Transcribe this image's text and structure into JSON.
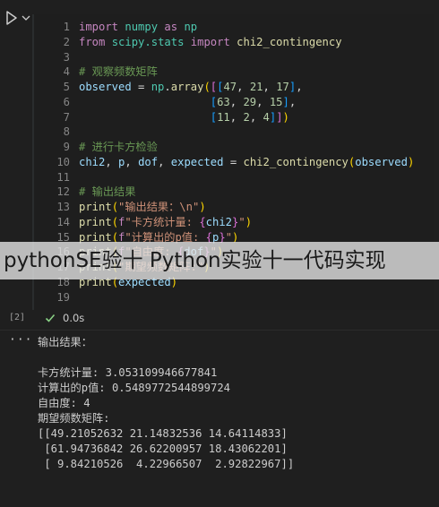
{
  "cell": {
    "execution_count": "[2]",
    "status_icon": "check-icon",
    "exec_time": "0.0s",
    "lines": [
      {
        "n": "1",
        "tokens": [
          [
            "kw",
            "import"
          ],
          [
            "op",
            " "
          ],
          [
            "mod",
            "numpy"
          ],
          [
            "op",
            " "
          ],
          [
            "kw",
            "as"
          ],
          [
            "op",
            " "
          ],
          [
            "mod",
            "np"
          ]
        ]
      },
      {
        "n": "2",
        "tokens": [
          [
            "kw",
            "from"
          ],
          [
            "op",
            " "
          ],
          [
            "mod",
            "scipy.stats"
          ],
          [
            "op",
            " "
          ],
          [
            "kw",
            "import"
          ],
          [
            "op",
            " "
          ],
          [
            "fn",
            "chi2_contingency"
          ]
        ]
      },
      {
        "n": "3",
        "tokens": []
      },
      {
        "n": "4",
        "tokens": [
          [
            "cm",
            "# 观察频数矩阵"
          ]
        ]
      },
      {
        "n": "5",
        "tokens": [
          [
            "var",
            "observed"
          ],
          [
            "op",
            " = "
          ],
          [
            "mod",
            "np"
          ],
          [
            "op",
            "."
          ],
          [
            "fn",
            "array"
          ],
          [
            "br1",
            "("
          ],
          [
            "br2",
            "["
          ],
          [
            "br3",
            "["
          ],
          [
            "num",
            "47"
          ],
          [
            "op",
            ", "
          ],
          [
            "num",
            "21"
          ],
          [
            "op",
            ", "
          ],
          [
            "num",
            "17"
          ],
          [
            "br3",
            "]"
          ],
          [
            "op",
            ","
          ]
        ]
      },
      {
        "n": "6",
        "tokens": [
          [
            "op",
            "                    "
          ],
          [
            "br3",
            "["
          ],
          [
            "num",
            "63"
          ],
          [
            "op",
            ", "
          ],
          [
            "num",
            "29"
          ],
          [
            "op",
            ", "
          ],
          [
            "num",
            "15"
          ],
          [
            "br3",
            "]"
          ],
          [
            "op",
            ","
          ]
        ]
      },
      {
        "n": "7",
        "tokens": [
          [
            "op",
            "                    "
          ],
          [
            "br3",
            "["
          ],
          [
            "num",
            "11"
          ],
          [
            "op",
            ", "
          ],
          [
            "num",
            "2"
          ],
          [
            "op",
            ", "
          ],
          [
            "num",
            "4"
          ],
          [
            "br3",
            "]"
          ],
          [
            "br2",
            "]"
          ],
          [
            "br1",
            ")"
          ]
        ]
      },
      {
        "n": "8",
        "tokens": []
      },
      {
        "n": "9",
        "tokens": [
          [
            "cm",
            "# 进行卡方检验"
          ]
        ]
      },
      {
        "n": "10",
        "tokens": [
          [
            "var",
            "chi2"
          ],
          [
            "op",
            ", "
          ],
          [
            "var",
            "p"
          ],
          [
            "op",
            ", "
          ],
          [
            "var",
            "dof"
          ],
          [
            "op",
            ", "
          ],
          [
            "var",
            "expected"
          ],
          [
            "op",
            " = "
          ],
          [
            "fn",
            "chi2_contingency"
          ],
          [
            "br1",
            "("
          ],
          [
            "var",
            "observed"
          ],
          [
            "br1",
            ")"
          ]
        ]
      },
      {
        "n": "11",
        "tokens": []
      },
      {
        "n": "12",
        "tokens": [
          [
            "cm",
            "# 输出结果"
          ]
        ]
      },
      {
        "n": "13",
        "tokens": [
          [
            "fn",
            "print"
          ],
          [
            "br1",
            "("
          ],
          [
            "str",
            "\"输出结果：\\n\""
          ],
          [
            "br1",
            ")"
          ]
        ]
      },
      {
        "n": "14",
        "tokens": [
          [
            "fn",
            "print"
          ],
          [
            "br1",
            "("
          ],
          [
            "kw",
            "f"
          ],
          [
            "str",
            "\"卡方统计量: "
          ],
          [
            "br2",
            "{"
          ],
          [
            "var",
            "chi2"
          ],
          [
            "br2",
            "}"
          ],
          [
            "str",
            "\""
          ],
          [
            "br1",
            ")"
          ]
        ]
      },
      {
        "n": "15",
        "tokens": [
          [
            "fn",
            "print"
          ],
          [
            "br1",
            "("
          ],
          [
            "kw",
            "f"
          ],
          [
            "str",
            "\"计算出的p值: "
          ],
          [
            "br2",
            "{"
          ],
          [
            "var",
            "p"
          ],
          [
            "br2",
            "}"
          ],
          [
            "str",
            "\""
          ],
          [
            "br1",
            ")"
          ]
        ]
      },
      {
        "n": "16",
        "tokens": [
          [
            "fn",
            "print"
          ],
          [
            "br1",
            "("
          ],
          [
            "kw",
            "f"
          ],
          [
            "str",
            "\"自由度: "
          ],
          [
            "br2",
            "{"
          ],
          [
            "var",
            "dof"
          ],
          [
            "br2",
            "}"
          ],
          [
            "str",
            "\""
          ],
          [
            "br1",
            ")"
          ]
        ]
      },
      {
        "n": "17",
        "tokens": [
          [
            "fn",
            "print"
          ],
          [
            "br1",
            "("
          ],
          [
            "str",
            "\"期望频数矩阵:\""
          ],
          [
            "br1",
            ")"
          ]
        ]
      },
      {
        "n": "18",
        "tokens": [
          [
            "fn",
            "print"
          ],
          [
            "br1",
            "("
          ],
          [
            "var",
            "expected"
          ],
          [
            "br1",
            ")"
          ]
        ]
      },
      {
        "n": "19",
        "tokens": []
      }
    ]
  },
  "output": {
    "menu_icon": "ellipsis-icon",
    "menu_text": "···",
    "lines": [
      "输出结果：",
      "",
      "卡方统计量: 3.053109946677841",
      "计算出的p值: 0.5489772544899724",
      "自由度: 4",
      "期望频数矩阵:",
      "[[49.21052632 21.14832536 14.64114833]",
      " [61.94736842 26.62200957 18.43062201]",
      " [ 9.84210526  4.22966507  2.92822967]]"
    ]
  },
  "watermark": {
    "text": "pythonSE验十 Python实验十一代码实现"
  },
  "colors": {
    "background": "#1f1f1f",
    "keyword": "#c586c0",
    "module": "#4ec9b0",
    "function": "#dcdcaa",
    "number": "#b5cea8",
    "string": "#ce9178",
    "variable": "#9cdcfe",
    "comment": "#6a9955",
    "success": "#89d185"
  }
}
